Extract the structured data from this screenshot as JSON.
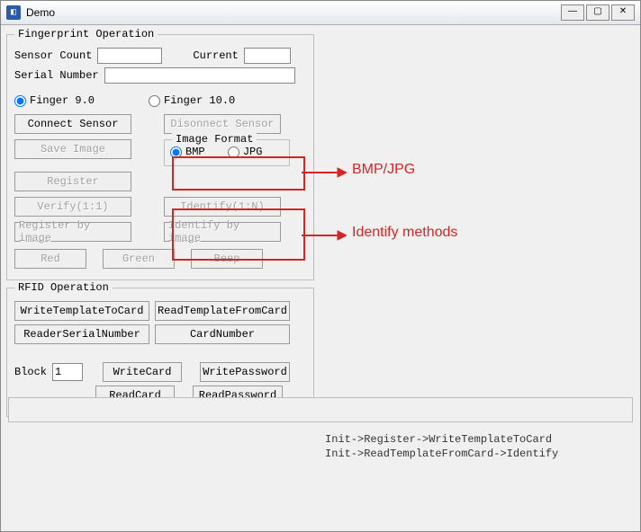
{
  "window": {
    "title": "Demo"
  },
  "fingerprint": {
    "legend": "Fingerprint Operation",
    "sensor_count": "Sensor Count",
    "current": "Current",
    "serial_number": "Serial Number",
    "finger90": "Finger 9.0",
    "finger100": "Finger 10.0",
    "connect": "Connect Sensor",
    "disconnect": "Disonnect Sensor",
    "save_image": "Save Image",
    "register": "Register",
    "verify": "Verify(1:1)",
    "identify": "Identify(1:N)",
    "register_by_img": "Register by image",
    "identify_by_img": "Identify by image",
    "red": "Red",
    "green": "Green",
    "beep": "Beep",
    "img_format": {
      "legend": "Image Format",
      "bmp": "BMP",
      "jpg": "JPG"
    }
  },
  "rfid": {
    "legend": "RFID Operation",
    "write_tpl": "WriteTemplateToCard",
    "read_tpl": "ReadTemplateFromCard",
    "reader_sn": "ReaderSerialNumber",
    "card_num": "CardNumber",
    "block_label": "Block",
    "block_value": "1",
    "write_card": "WriteCard",
    "read_card": "ReadCard",
    "write_pw": "WritePassword",
    "read_pw": "ReadPassword"
  },
  "hints": {
    "line1": "Init->Register->WriteTemplateToCard",
    "line2": "Init->ReadTemplateFromCard->Identify"
  },
  "annotations": {
    "bmp_jpg": "BMP/JPG",
    "identify": "Identify methods"
  }
}
